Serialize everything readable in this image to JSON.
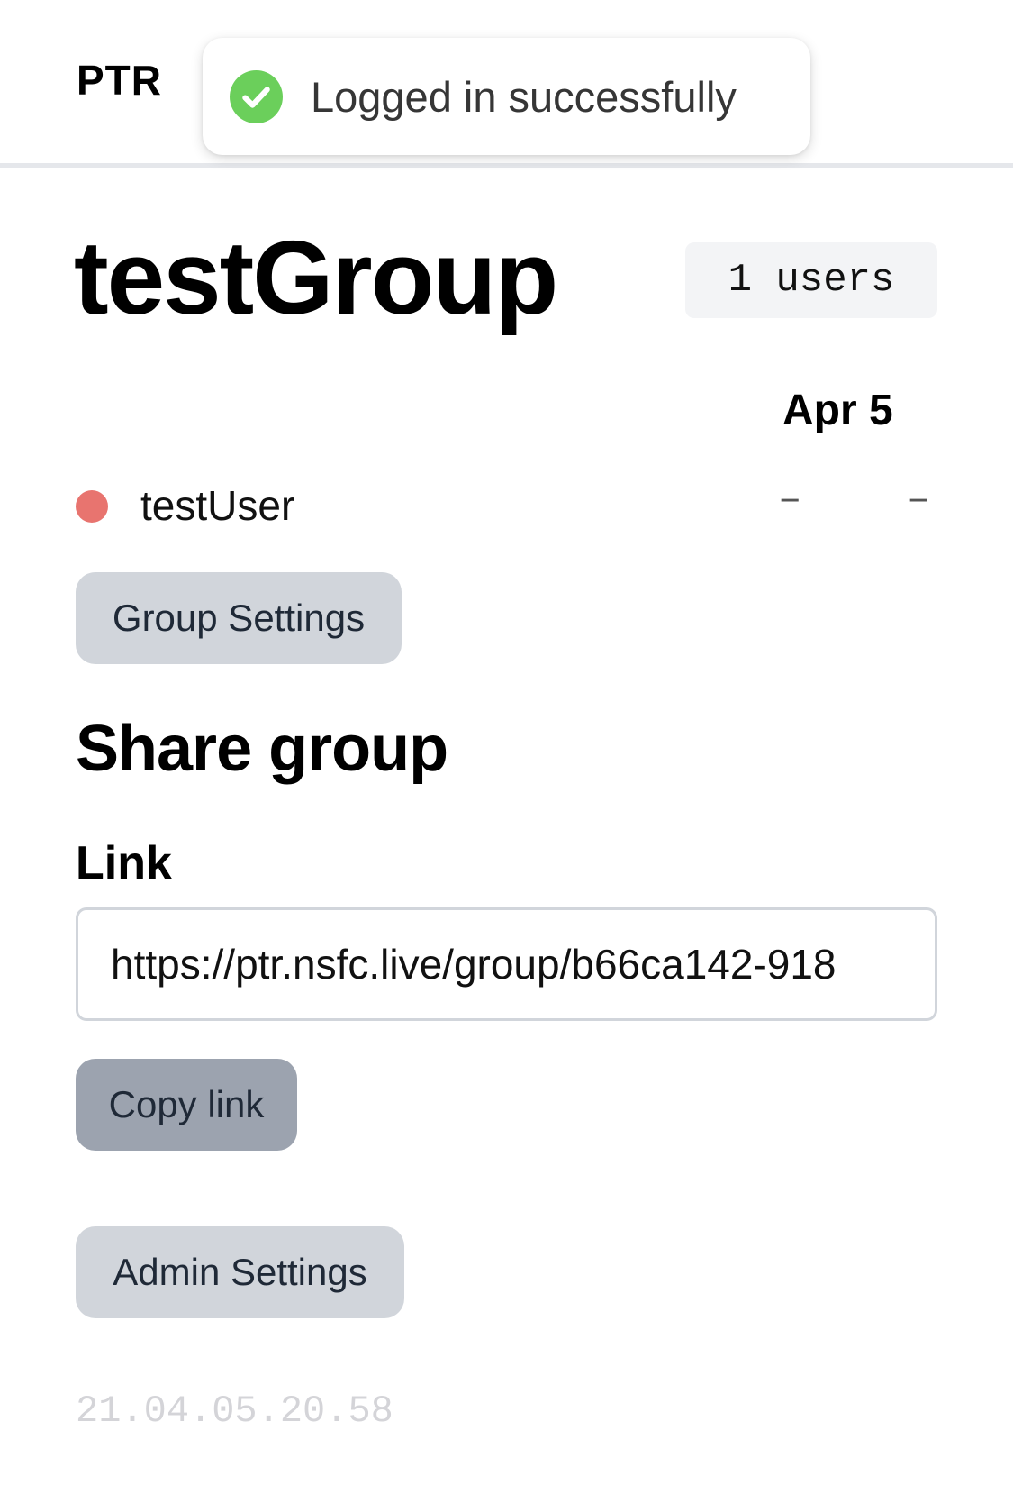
{
  "header": {
    "brand": "PTR"
  },
  "toast": {
    "message": "Logged in successfully",
    "icon": "check-circle-icon",
    "icon_color": "#6bcf5b"
  },
  "group": {
    "name": "testGroup",
    "user_count_label": "1 users",
    "date_header": "Apr 5",
    "members": [
      {
        "name": "testUser",
        "status_color": "#e8746f",
        "values": [
          "–",
          "–"
        ]
      }
    ]
  },
  "actions": {
    "group_settings_label": "Group Settings",
    "copy_link_label": "Copy link",
    "admin_settings_label": "Admin Settings"
  },
  "share": {
    "title": "Share group",
    "link_label": "Link",
    "link_value": "https://ptr.nsfc.live/group/b66ca142-918"
  },
  "footer": {
    "version": "21.04.05.20.58"
  }
}
